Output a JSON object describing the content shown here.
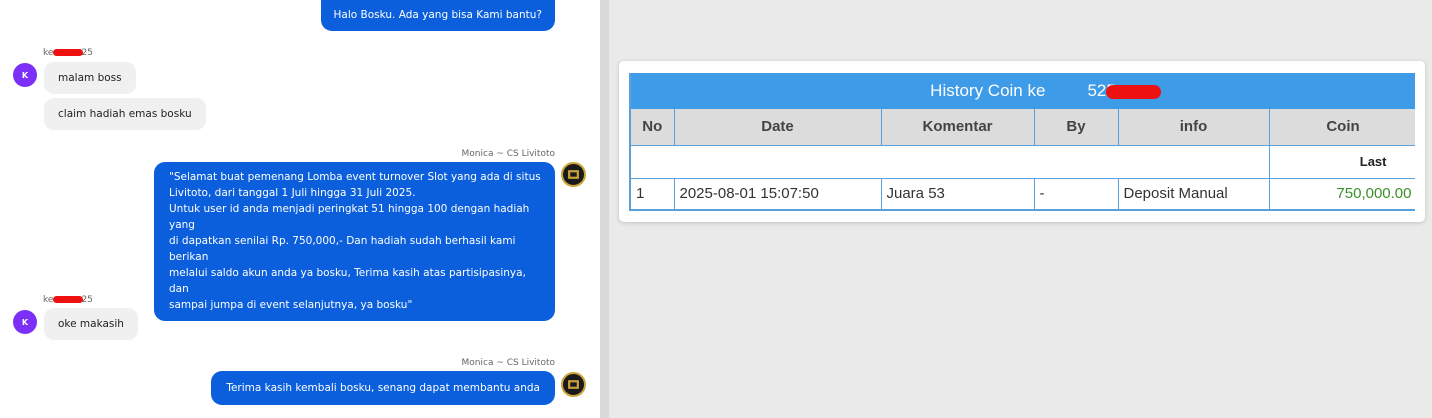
{
  "chat": {
    "messages": [
      {
        "type": "out",
        "text": "Halo Bosku. Ada yang bisa Kami bantu?"
      },
      {
        "type": "in",
        "sender_prefix": "ke",
        "sender_suffix": "25",
        "avatar": "K",
        "bubbles": [
          "malam boss",
          "claim hadiah emas bosku"
        ]
      },
      {
        "type": "out",
        "sender": "Monica ~ CS Livitoto",
        "lines": [
          "\"Selamat buat pemenang Lomba event turnover Slot yang ada di situs",
          "Livitoto, dari tanggal 1 Juli hingga 31 Juli 2025.",
          "Untuk user id anda menjadi peringkat 51 hingga 100 dengan hadiah yang",
          "di dapatkan senilai Rp. 750,000,- Dan hadiah sudah berhasil kami berikan",
          "melalui saldo akun anda ya bosku, Terima kasih atas partisipasinya, dan",
          "sampai jumpa di event selanjutnya, ya bosku\""
        ]
      },
      {
        "type": "in",
        "sender_prefix": "ke",
        "sender_suffix": "25",
        "avatar": "K",
        "bubbles": [
          "oke makasih"
        ]
      },
      {
        "type": "out",
        "sender": "Monica ~ CS Livitoto",
        "text": "Terima kasih kembali bosku, senang dapat membantu anda"
      }
    ]
  },
  "history": {
    "title_prefix": "History Coin ke",
    "title_suffix": "525",
    "columns": [
      "No",
      "Date",
      "Komentar",
      "By",
      "info",
      "Coin"
    ],
    "subheader": "Last",
    "rows": [
      {
        "no": "1",
        "date": "2025-08-01 15:07:50",
        "komentar": "Juara 53",
        "by": "-",
        "info": "Deposit Manual",
        "coin": "750,000.00"
      }
    ]
  }
}
